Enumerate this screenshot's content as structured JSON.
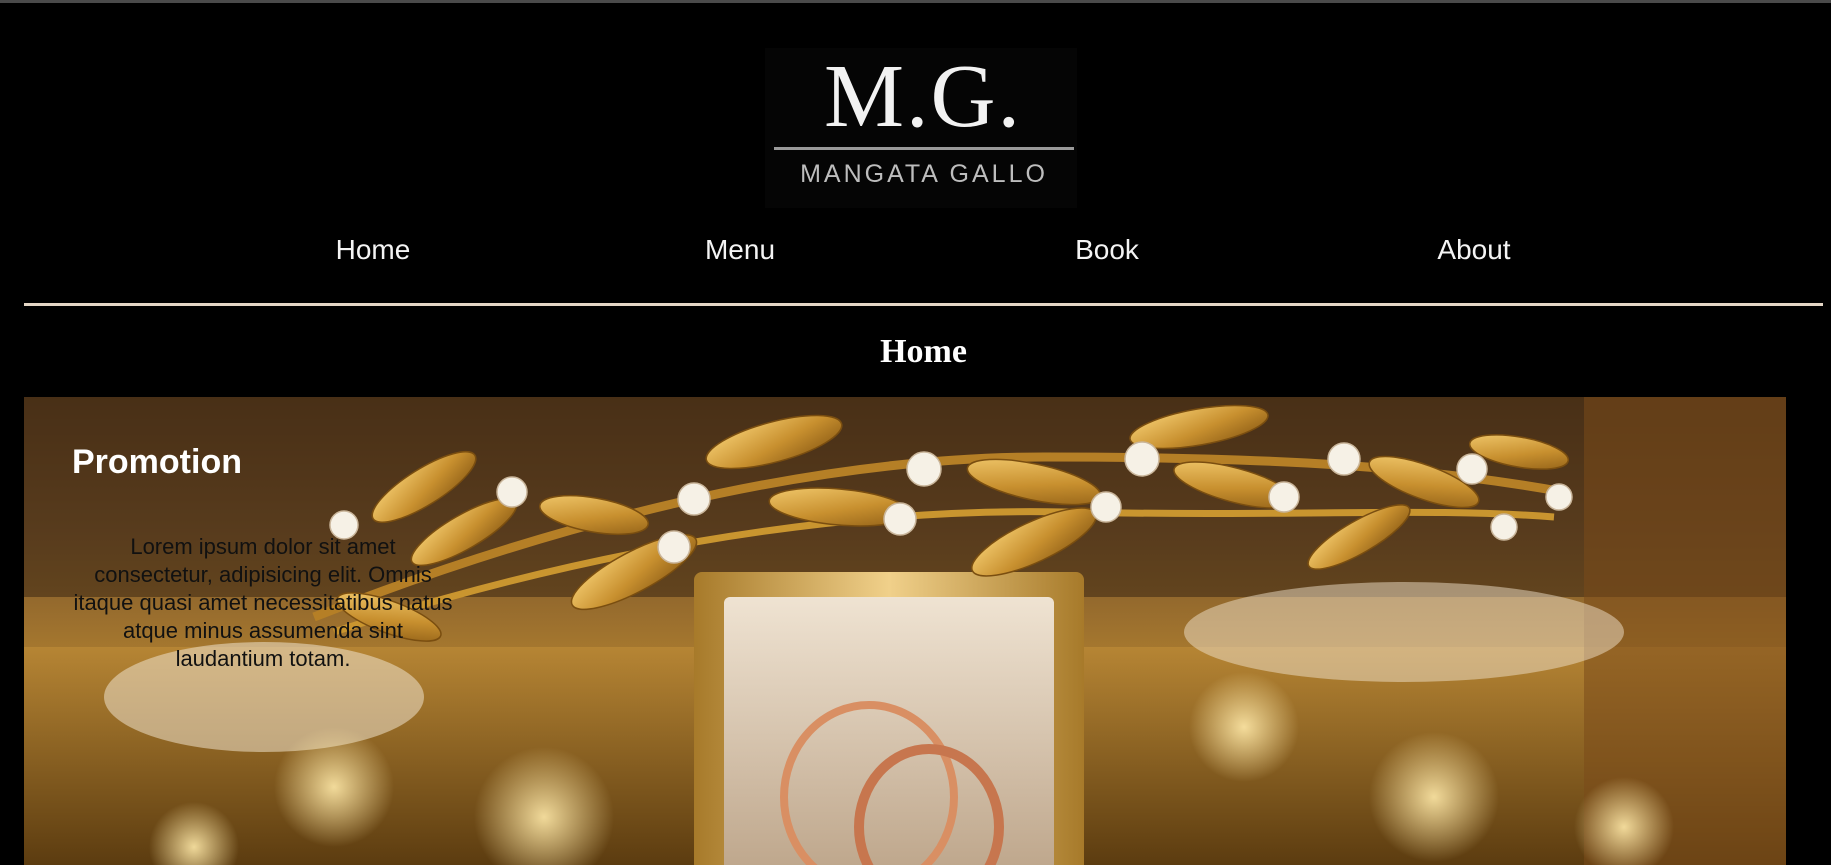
{
  "brand": {
    "logo_mark": "M.G.",
    "logo_name": "MANGATA GALLO"
  },
  "nav": {
    "items": [
      {
        "label": "Home"
      },
      {
        "label": "Menu"
      },
      {
        "label": "Book"
      },
      {
        "label": "About"
      }
    ]
  },
  "page": {
    "title": "Home"
  },
  "promotion": {
    "title": "Promotion",
    "text": "Lorem ipsum dolor sit amet consectetur, adipisicing elit. Omnis itaque quasi amet necessitatibus natus atque minus assumenda sint laudantium totam."
  },
  "colors": {
    "background": "#000000",
    "divider": "#e4d6c6",
    "text": "#ffffff",
    "gold": "#c8902f"
  }
}
